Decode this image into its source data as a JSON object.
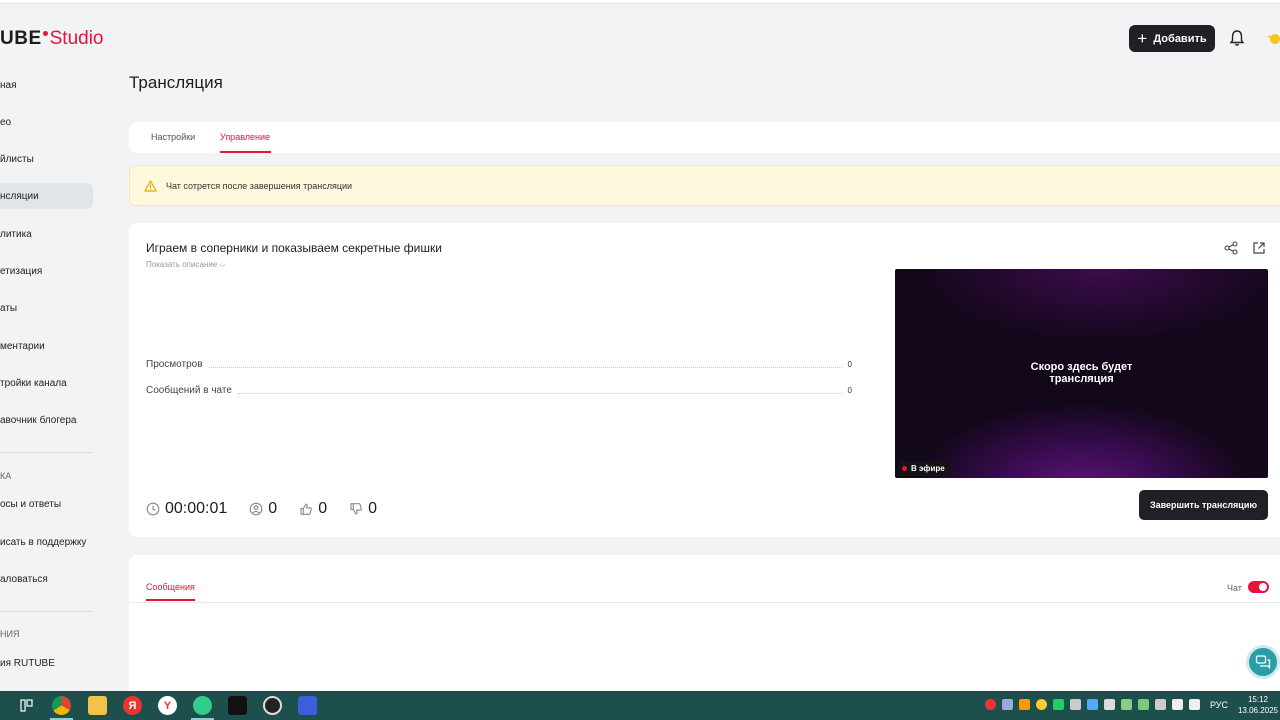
{
  "brand": {
    "logo_part1": "UBE",
    "logo_part2": "Studio"
  },
  "header": {
    "add_label": "Добавить"
  },
  "sidebar": {
    "items": [
      "ная",
      "ео",
      "йлисты",
      "нсляции",
      "литика",
      "етизация",
      "аты",
      "ментарии",
      "тройки канала",
      "авочник блогера"
    ],
    "section_support": "КА",
    "support_items": [
      "осы и ответы",
      "исать в поддержку",
      "аловаться"
    ],
    "section_other": "НИЯ",
    "other_items": [
      "ия RUTUBE"
    ]
  },
  "page": {
    "title": "Трансляция"
  },
  "tabs": [
    {
      "label": "Настройки"
    },
    {
      "label": "Управление"
    }
  ],
  "warning": {
    "text": "Чат сотрется после завершения трансляции"
  },
  "stream": {
    "title": "Играем в соперники и показываем секретные фишки",
    "show_description": "Показать описание",
    "stats": [
      {
        "label": "Просмотров",
        "value": "0"
      },
      {
        "label": "Сообщений в чате",
        "value": "0"
      }
    ],
    "player_message_line1": "Скоро здесь будет",
    "player_message_line2": "трансляция",
    "live_badge": "В эфире",
    "duration": "00:00:01",
    "viewers": "0",
    "likes": "0",
    "dislikes": "0",
    "end_button": "Завершить трансляцию"
  },
  "messages": {
    "tab_label": "Сообщения",
    "chat_label": "Чат",
    "chat_enabled": true
  },
  "taskbar": {
    "lang": "РУС",
    "time": "15:12",
    "date": "13.06.2025"
  },
  "colors": {
    "accent": "#e8133d",
    "dark_button": "#1f2126",
    "taskbar": "#1d4f4d"
  }
}
